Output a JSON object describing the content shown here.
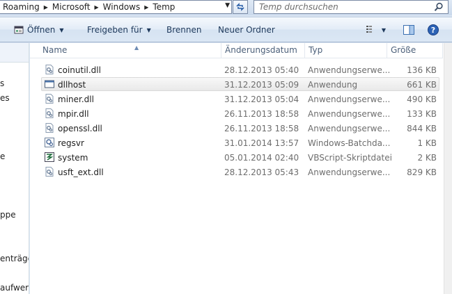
{
  "address": {
    "crumbs": [
      "Roaming",
      "Microsoft",
      "Windows",
      "Temp"
    ]
  },
  "search": {
    "placeholder": "Temp durchsuchen"
  },
  "toolbar": {
    "open_label": "Öffnen",
    "share_label": "Freigeben für",
    "burn_label": "Brennen",
    "new_folder_label": "Neuer Ordner"
  },
  "nav": {
    "items": [
      "s",
      "es",
      "e",
      "ppe",
      "enträge",
      "aufwerk"
    ]
  },
  "columns": {
    "name": "Name",
    "date": "Änderungsdatum",
    "type": "Typ",
    "size": "Größe"
  },
  "files": [
    {
      "name": "coinutil.dll",
      "date": "28.12.2013 05:40",
      "type": "Anwendungserwe...",
      "size": "136 KB",
      "icon": "dll-icon"
    },
    {
      "name": "dllhost",
      "date": "31.12.2013 05:09",
      "type": "Anwendung",
      "size": "661 KB",
      "icon": "exe-icon"
    },
    {
      "name": "miner.dll",
      "date": "31.12.2013 05:04",
      "type": "Anwendungserwe...",
      "size": "490 KB",
      "icon": "dll-icon"
    },
    {
      "name": "mpir.dll",
      "date": "26.11.2013 18:58",
      "type": "Anwendungserwe...",
      "size": "133 KB",
      "icon": "dll-icon"
    },
    {
      "name": "openssl.dll",
      "date": "26.11.2013 18:58",
      "type": "Anwendungserwe...",
      "size": "844 KB",
      "icon": "dll-icon"
    },
    {
      "name": "regsvr",
      "date": "31.01.2014 13:57",
      "type": "Windows-Batchda...",
      "size": "1 KB",
      "icon": "batch-icon"
    },
    {
      "name": "system",
      "date": "05.01.2014 02:40",
      "type": "VBScript-Skriptdatei",
      "size": "2 KB",
      "icon": "vbscript-icon"
    },
    {
      "name": "usft_ext.dll",
      "date": "28.12.2013 05:43",
      "type": "Anwendungserwe...",
      "size": "829 KB",
      "icon": "dll-icon"
    }
  ],
  "selected_index": 1
}
